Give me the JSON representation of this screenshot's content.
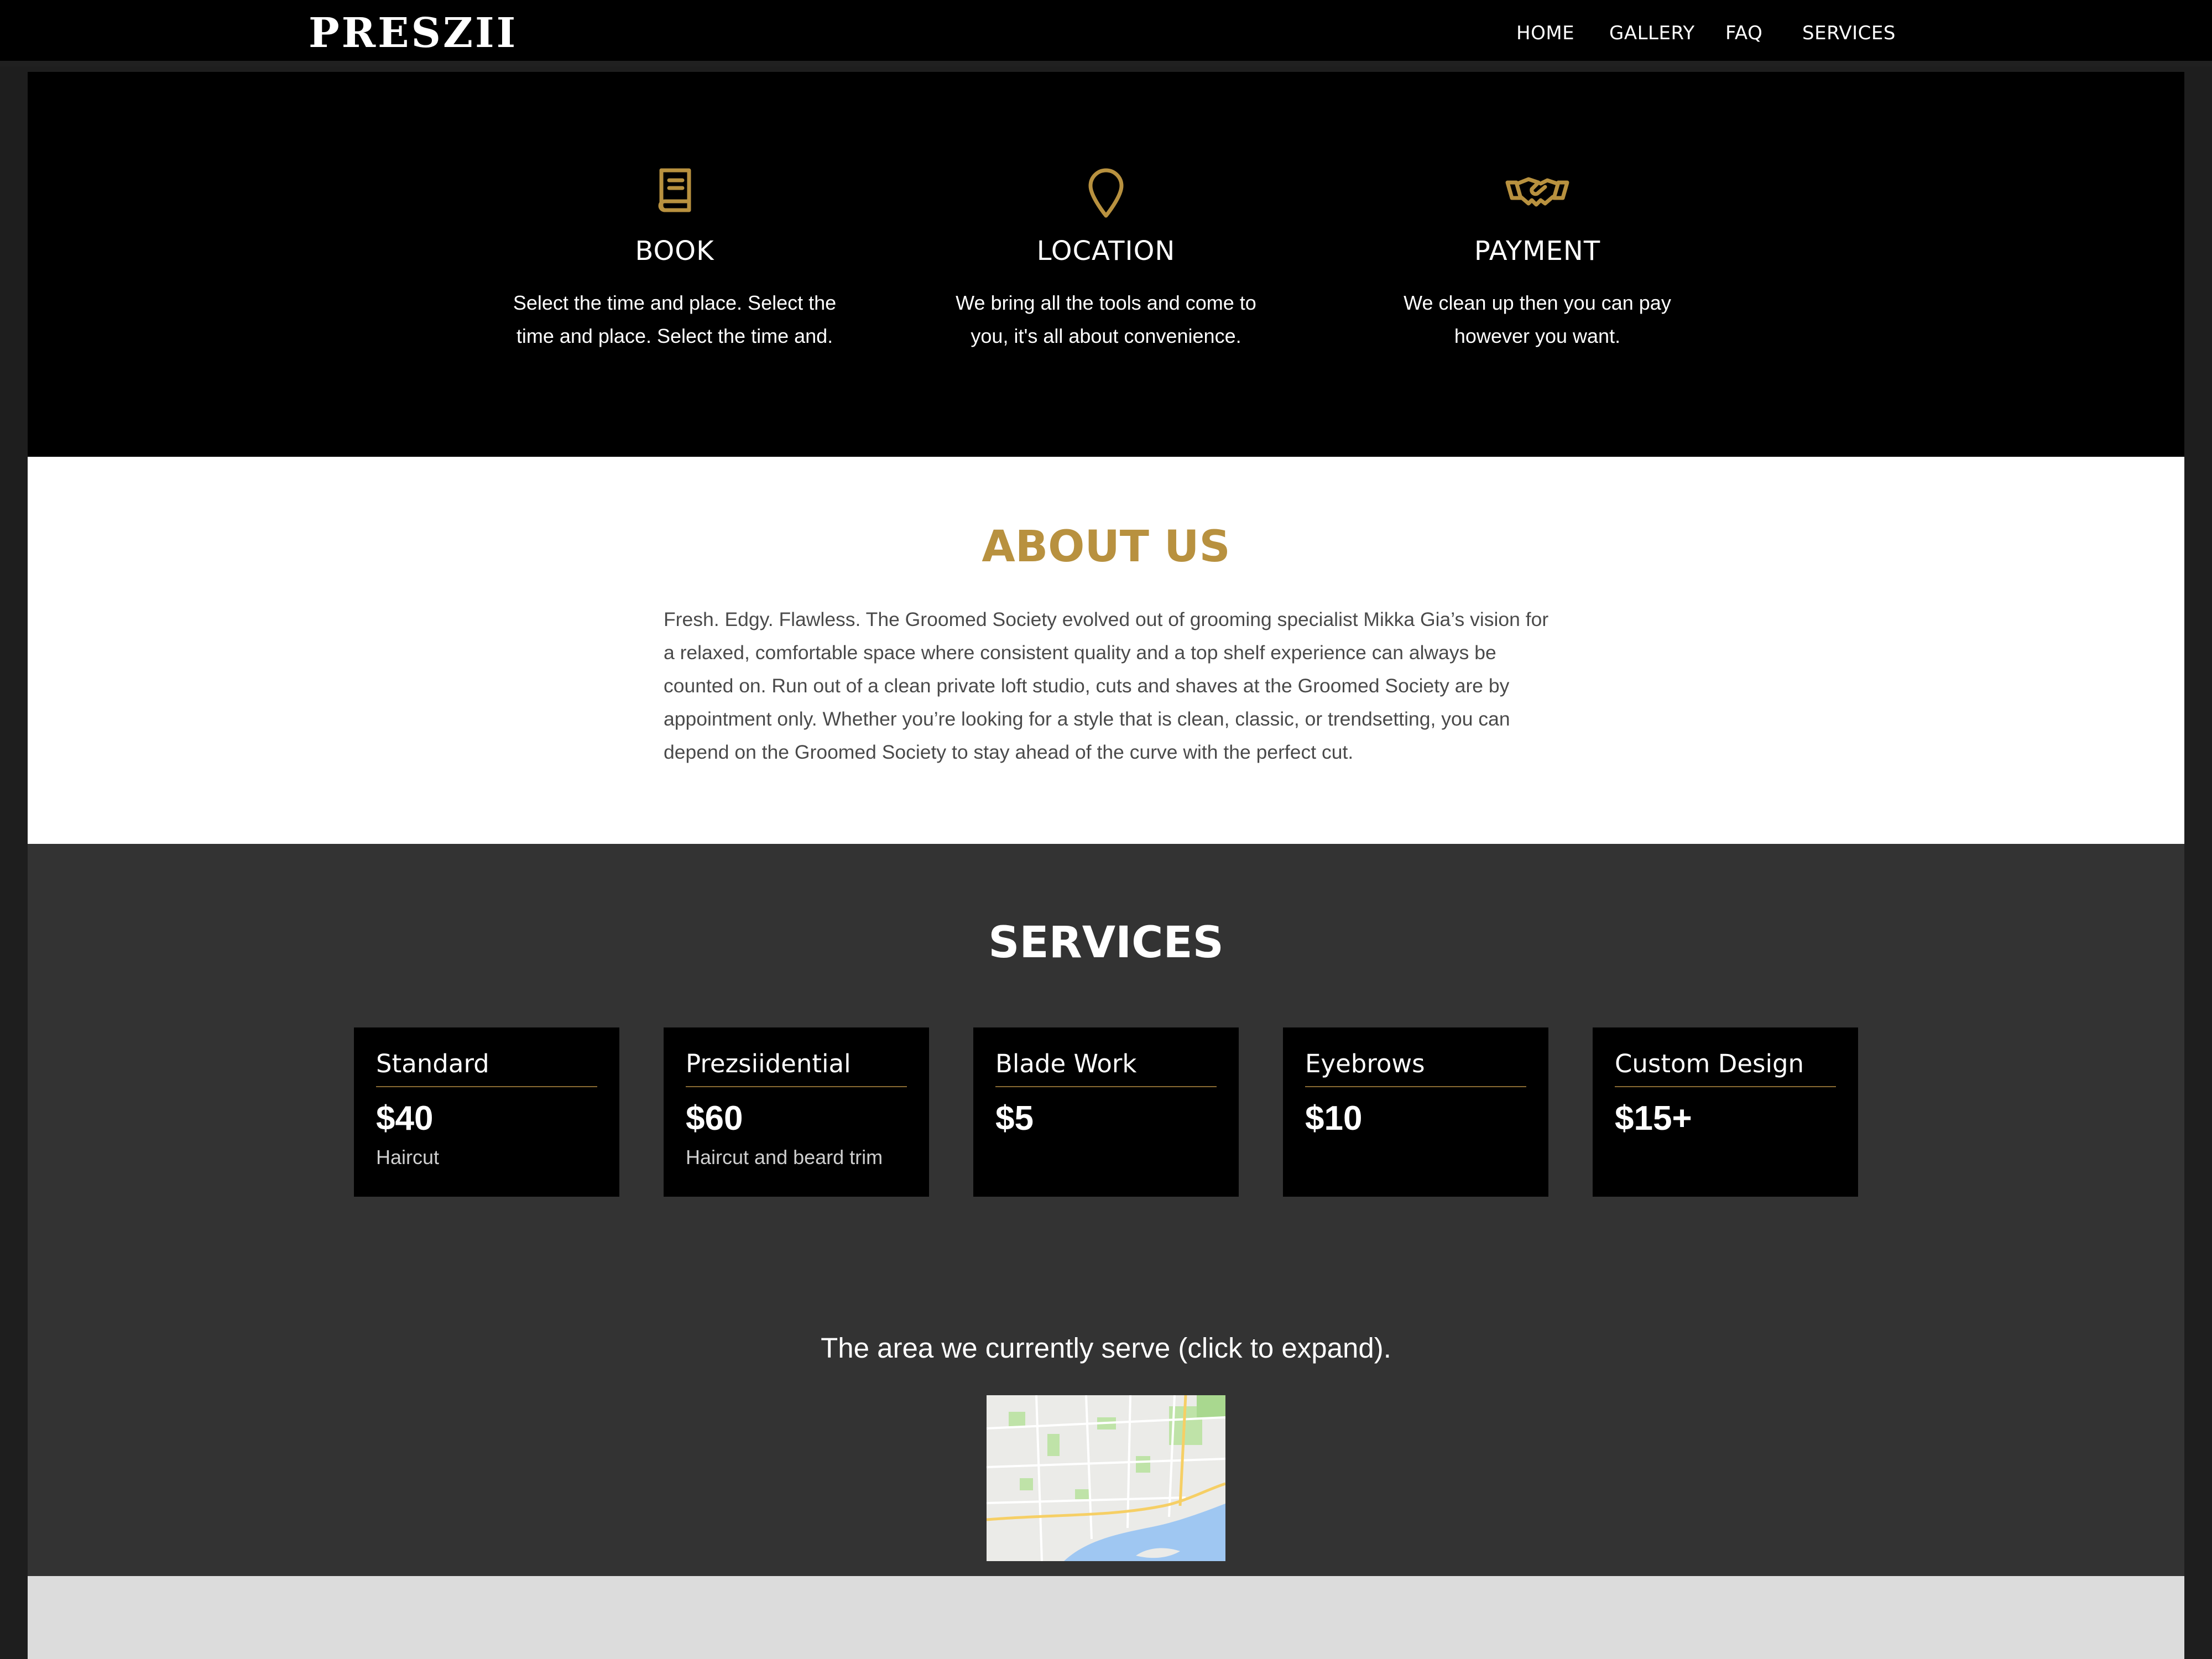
{
  "header": {
    "logo": "PRESZII",
    "nav": [
      "HOME",
      "GALLERY",
      "FAQ",
      "SERVICES"
    ]
  },
  "features": [
    {
      "icon": "book-icon",
      "title": "BOOK",
      "text": "Select the time and place. Select the time and place. Select the time and."
    },
    {
      "icon": "location-pin-icon",
      "title": "LOCATION",
      "text": "We bring all the tools and come to you, it's all about convenience."
    },
    {
      "icon": "handshake-icon",
      "title": "PAYMENT",
      "text": "We clean up then you can pay however you want."
    }
  ],
  "about": {
    "title": "ABOUT US",
    "text": "Fresh. Edgy. Flawless. The Groomed Society evolved out of grooming specialist Mikka Gia’s vision for a relaxed, comfortable space where consistent quality and a top shelf experience can always be counted on. Run out of a clean private loft studio, cuts and shaves at the Groomed Society are by appointment only. Whether you’re looking for a style that is clean, classic, or trendsetting, you can depend on the Groomed Society to stay ahead of the curve with the perfect cut."
  },
  "services": {
    "title": "SERVICES",
    "items": [
      {
        "name": "Standard",
        "price": "$40",
        "desc": "Haircut"
      },
      {
        "name": "Prezsiidential",
        "price": "$60",
        "desc": "Haircut and beard trim"
      },
      {
        "name": "Blade Work",
        "price": "$5",
        "desc": ""
      },
      {
        "name": "Eyebrows",
        "price": "$10",
        "desc": ""
      },
      {
        "name": "Custom Design",
        "price": "$15+",
        "desc": ""
      }
    ],
    "area_text": "The area we currently serve (click to expand).",
    "map_icon": "map-thumbnail"
  },
  "colors": {
    "accent": "#b8913f",
    "black": "#000000",
    "dark_section": "#333333",
    "light_section": "#dcdcdc"
  }
}
